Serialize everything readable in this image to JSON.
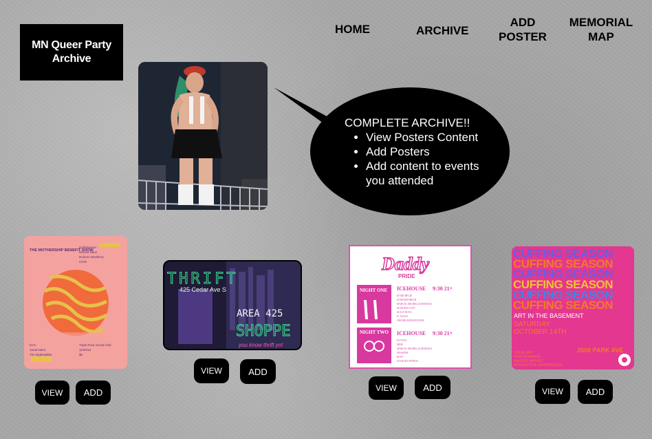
{
  "header": {
    "logo_text": "MN Queer Party Archive"
  },
  "nav": {
    "home": "HOME",
    "archive": "ARCHIVE",
    "add_poster_line1": "ADD",
    "add_poster_line2": "POSTER",
    "memorial_line1": "MEMORIAL",
    "memorial_line2": "MAP"
  },
  "hero": {
    "headline": "COMPLETE ARCHIVE!!",
    "bullets": [
      "View Posters Content",
      "Add Posters",
      "Add content to events you attended"
    ]
  },
  "posters": [
    {
      "view_label": "VIEW",
      "add_label": "ADD",
      "title_left": "THE MOTHERSHIP BENEFIT SHOW",
      "title_right_1": "Dollsdeemer",
      "title_right_2": "Desoto Daun",
      "title_right_3": "Dolores Dewberry",
      "title_right_4": "COW",
      "djs_label": "DJ's:",
      "dj_1": "Jarod Neira",
      "dj_2": "The Nightstalker",
      "venue": "Triple Rock Social Club",
      "date": "11/20/16",
      "price": "$5"
    },
    {
      "view_label": "VIEW",
      "add_label": "ADD",
      "line1": "THRIFT",
      "line2": "425 Cedar Ave S",
      "line3": "AREA 425",
      "line4": "SHOPPE",
      "line5": "you know thrift yo!"
    },
    {
      "view_label": "VIEW",
      "add_label": "ADD",
      "title": "Daddy",
      "subtitle": "PRIDE",
      "night_one": "NIGHT ONE",
      "night_two": "NIGHT TWO",
      "venue_1": "ICEHOUSE",
      "venue_2": "ICEHOUSE",
      "time_age_1": "9:30 21+",
      "time_age_2": "9:30 21+",
      "lineup_1": [
        "DJ MICHELIE",
        "DJ HEARTSBEAR",
        "MARCEL MICHELLE-MORANA",
        "ELEKTRA CUTE",
        "SULLY BOYS",
        "D. ALLEN",
        "ARCHIE BONGIOVANNI"
      ],
      "lineup_2": [
        "DJ YONI",
        "MIDE",
        "MARCEL MICHELLE-MORANA",
        "PRAWDIN",
        "ROSY",
        "JUNAUDA PETRUS"
      ]
    },
    {
      "view_label": "VIEW",
      "add_label": "ADD",
      "repeat_title": "CUFFING SEASON",
      "event": "ART IN THE BASEMENT",
      "date_line1": "SATURDAY",
      "date_line2": "OCTOBER 14TH",
      "address": "3508 PARK AVE",
      "features": [
        "VISUAL ART",
        "PERFORMANCE",
        "MAKERS MARKET",
        "INTERACTIVE EXPERIENCES"
      ]
    }
  ],
  "colors": {
    "background": "#a7a7a7",
    "black": "#000000",
    "white": "#ffffff"
  }
}
